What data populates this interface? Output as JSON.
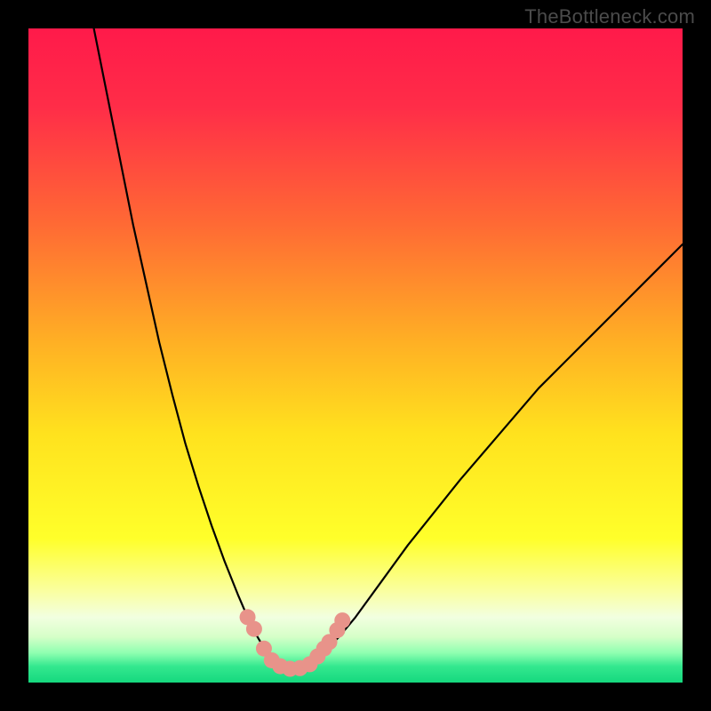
{
  "watermark": "TheBottleneck.com",
  "chart_data": {
    "type": "line",
    "title": "",
    "xlabel": "",
    "ylabel": "",
    "xlim": [
      0,
      100
    ],
    "ylim": [
      0,
      100
    ],
    "gradient_stops": [
      {
        "offset": 0.0,
        "color": "#ff1a4a"
      },
      {
        "offset": 0.12,
        "color": "#ff2d48"
      },
      {
        "offset": 0.3,
        "color": "#ff6a34"
      },
      {
        "offset": 0.48,
        "color": "#ffb024"
      },
      {
        "offset": 0.62,
        "color": "#ffe21e"
      },
      {
        "offset": 0.78,
        "color": "#ffff2a"
      },
      {
        "offset": 0.86,
        "color": "#faffa0"
      },
      {
        "offset": 0.9,
        "color": "#f2ffe0"
      },
      {
        "offset": 0.93,
        "color": "#d6ffc8"
      },
      {
        "offset": 0.955,
        "color": "#8effb0"
      },
      {
        "offset": 0.975,
        "color": "#34e88f"
      },
      {
        "offset": 1.0,
        "color": "#15d87e"
      }
    ],
    "series": [
      {
        "name": "left-branch",
        "x": [
          10,
          12,
          14,
          16,
          18,
          20,
          22,
          24,
          26,
          28,
          30,
          32,
          33.5,
          35,
          36.2,
          37.2,
          38
        ],
        "y": [
          100,
          90,
          80,
          70,
          61,
          52,
          44,
          36.5,
          30,
          24,
          18.5,
          13.5,
          10,
          7,
          5,
          3.5,
          2.7
        ]
      },
      {
        "name": "right-branch",
        "x": [
          43,
          44,
          45.5,
          47.5,
          50,
          54,
          58,
          62,
          66,
          72,
          78,
          84,
          90,
          96,
          100
        ],
        "y": [
          2.7,
          3.6,
          5,
          7,
          10,
          15.5,
          21,
          26,
          31,
          38,
          45,
          51,
          57,
          63,
          67
        ]
      },
      {
        "name": "floor",
        "x": [
          38,
          39,
          40,
          41,
          42,
          43
        ],
        "y": [
          2.7,
          2.3,
          2.1,
          2.1,
          2.3,
          2.7
        ]
      }
    ],
    "markers": {
      "name": "highlight-dots",
      "color": "#e8938a",
      "radius": 9,
      "points": [
        {
          "x": 33.5,
          "y": 10.0
        },
        {
          "x": 34.5,
          "y": 8.2
        },
        {
          "x": 36.0,
          "y": 5.2
        },
        {
          "x": 37.2,
          "y": 3.4
        },
        {
          "x": 38.5,
          "y": 2.5
        },
        {
          "x": 40.0,
          "y": 2.1
        },
        {
          "x": 41.5,
          "y": 2.2
        },
        {
          "x": 43.0,
          "y": 2.8
        },
        {
          "x": 44.2,
          "y": 4.0
        },
        {
          "x": 45.2,
          "y": 5.2
        },
        {
          "x": 46.0,
          "y": 6.2
        },
        {
          "x": 47.2,
          "y": 8.0
        },
        {
          "x": 48.0,
          "y": 9.5
        }
      ]
    }
  }
}
